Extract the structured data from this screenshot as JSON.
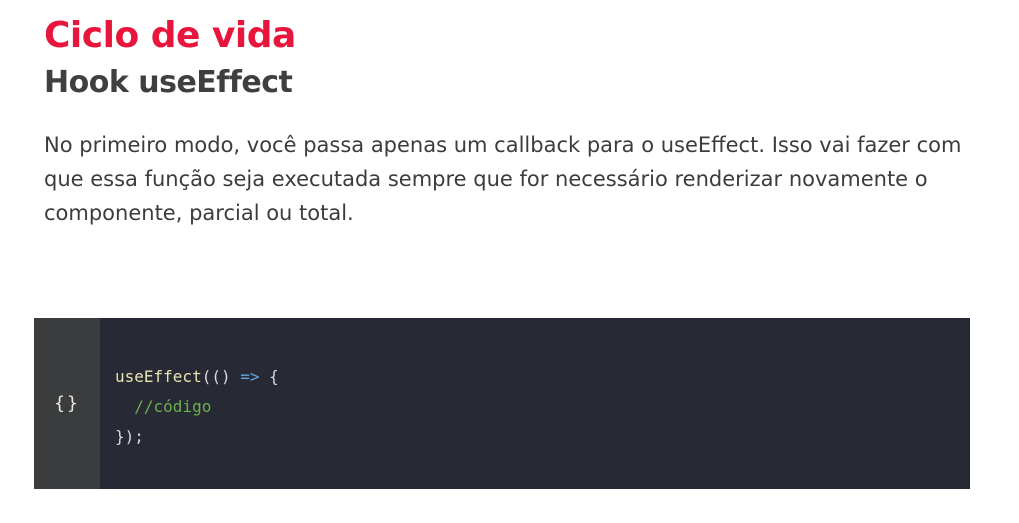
{
  "header": {
    "title": "Ciclo de vida",
    "subtitle": "Hook useEffect"
  },
  "body": {
    "paragraph": "No primeiro modo, você passa apenas um callback para o useEffect. Isso vai fazer com que essa função seja executada sempre que for necessário renderizar novamente o componente, parcial ou total."
  },
  "code_block": {
    "icon_label": "{}",
    "icon_name": "code-braces-icon",
    "lines": {
      "l1": {
        "fn": "useEffect",
        "open": "(() ",
        "arrow": "=>",
        "brace": " {"
      },
      "l2": {
        "indent": "  ",
        "comment": "//código"
      },
      "l3": {
        "close": "});"
      }
    }
  },
  "colors": {
    "title": "#e8163c",
    "subtitle": "#3f3f3f",
    "code_background": "#272935",
    "code_gutter": "#3b3c3d"
  }
}
